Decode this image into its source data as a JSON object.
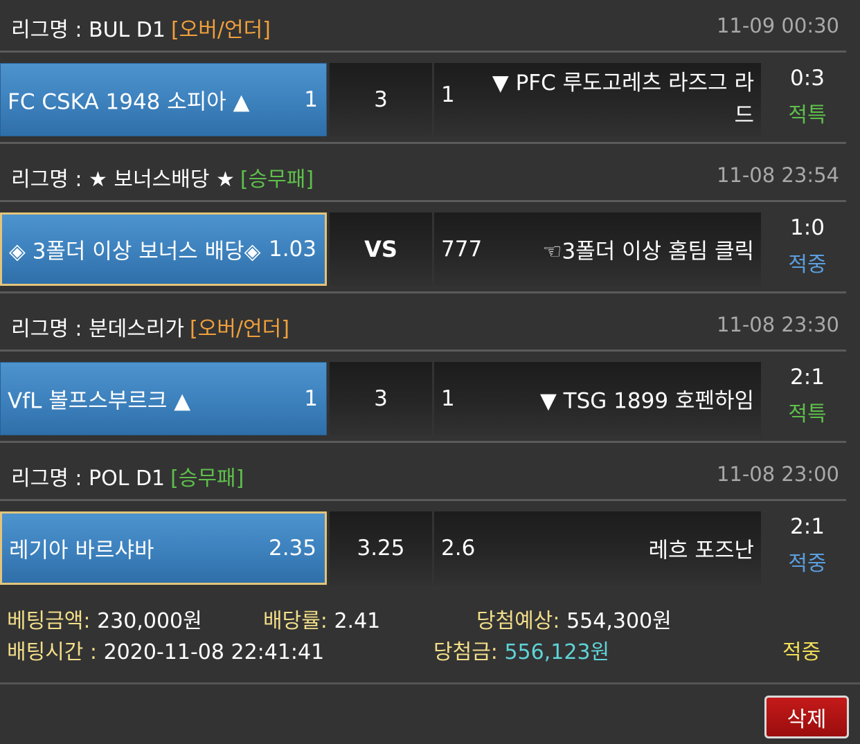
{
  "bets": [
    {
      "league_prefix": "리그명 : ",
      "league_name": "BUL D1",
      "bet_type": "[오버/언더]",
      "datetime": "11-09 00:30",
      "home_name": "FC CSKA 1948 소피아 ▲",
      "home_odds": "1",
      "draw": "3",
      "away_odds": "1",
      "away_name": "▼ PFC 루도고레츠 라즈그 라드",
      "score": "0:3",
      "result": "적특"
    },
    {
      "league_prefix": "리그명 : ",
      "league_name": "★ 보너스배당 ★",
      "bet_type": "[승무패]",
      "datetime": "11-08 23:54",
      "home_name": "◈ 3폴더 이상 보너스 배당◈",
      "home_odds": "1.03",
      "draw": "VS",
      "away_odds": "777",
      "away_name": "☜3폴더 이상 홈팀 클릭",
      "score": "1:0",
      "result": "적중"
    },
    {
      "league_prefix": "리그명 : ",
      "league_name": "분데스리가",
      "bet_type": "[오버/언더]",
      "datetime": "11-08 23:30",
      "home_name": "VfL 볼프스부르크 ▲",
      "home_odds": "1",
      "draw": "3",
      "away_odds": "1",
      "away_name": "▼ TSG 1899 호펜하임",
      "score": "2:1",
      "result": "적특"
    },
    {
      "league_prefix": "리그명 : ",
      "league_name": "POL D1",
      "bet_type": "[승무패]",
      "datetime": "11-08 23:00",
      "home_name": "레기아 바르샤바",
      "home_odds": "2.35",
      "draw": "3.25",
      "away_odds": "2.6",
      "away_name": "레흐 포즈난",
      "score": "2:1",
      "result": "적중"
    }
  ],
  "summary": {
    "bet_amount_label": "베팅금액:",
    "bet_amount": "230,000원",
    "odds_label": "배당률:",
    "odds": "2.41",
    "expected_label": "당첨예상:",
    "expected": "554,300원",
    "time_label": "배팅시간 :",
    "time": "2020-11-08 22:41:41",
    "win_label": "당첨금:",
    "win_amount": "556,123원",
    "status": "적중"
  },
  "delete_label": "삭제",
  "colors": {
    "background": "#333333",
    "home_blue": "#3f84c0",
    "selected_border": "#e3c47a",
    "over_under": "#f0a03c",
    "win_draw_loss": "#5ec04b",
    "hit": "#5b9fe0",
    "payout": "#5fd3d8",
    "delete_button": "#b01414"
  }
}
